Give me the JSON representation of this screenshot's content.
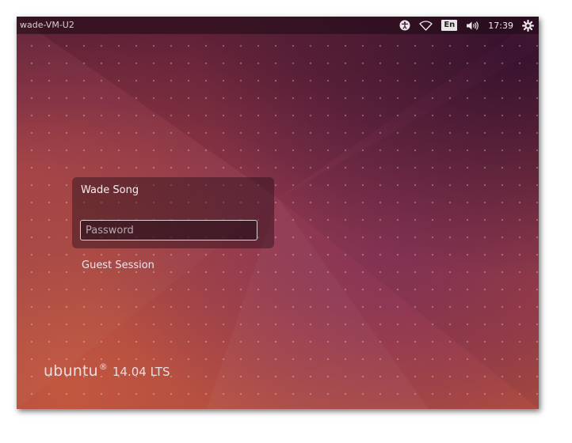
{
  "topbar": {
    "hostname": "wade-VM-U2",
    "icons": {
      "accessibility": "accessibility-icon",
      "network": "wifi-icon",
      "sound": "volume-icon",
      "session": "gear-icon"
    },
    "keyboard_layout": "En",
    "clock": "17:39"
  },
  "login": {
    "user_name": "Wade Song",
    "password_placeholder": "Password",
    "password_value": "",
    "guest_session": "Guest Session"
  },
  "branding": {
    "os_name": "ubuntu",
    "registered_mark": "®",
    "version": "14.04 LTS"
  },
  "colors": {
    "wallpaper_dark": "#5a1e36",
    "wallpaper_orange": "#c2573f",
    "wallpaper_pink": "#8a3558"
  }
}
